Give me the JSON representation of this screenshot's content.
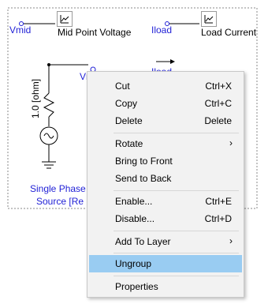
{
  "schematic": {
    "vmid_label": "Vmid",
    "mid_point_voltage": "Mid Point Voltage",
    "iload_label_top": "Iload",
    "load_current": "Load Current",
    "vmid_label_2": "Vmid",
    "iload_label_2": "Iload",
    "resistor_label": "1.0 [ohm]",
    "source_label_line1": "Single Phase",
    "source_label_line2": "Source [Re"
  },
  "context_menu": {
    "cut": {
      "label": "Cut",
      "shortcut": "Ctrl+X"
    },
    "copy": {
      "label": "Copy",
      "shortcut": "Ctrl+C"
    },
    "delete": {
      "label": "Delete",
      "shortcut": "Delete"
    },
    "rotate": {
      "label": "Rotate"
    },
    "bring_to_front": {
      "label": "Bring to Front"
    },
    "send_to_back": {
      "label": "Send to Back"
    },
    "enable": {
      "label": "Enable...",
      "shortcut": "Ctrl+E"
    },
    "disable": {
      "label": "Disable...",
      "shortcut": "Ctrl+D"
    },
    "add_to_layer": {
      "label": "Add To Layer"
    },
    "ungroup": {
      "label": "Ungroup"
    },
    "properties": {
      "label": "Properties"
    },
    "submenu_arrow": "›"
  },
  "colors": {
    "highlight": "#99ccf2",
    "label_blue": "#1f1fd6",
    "menu_bg": "#f2f2f2"
  }
}
